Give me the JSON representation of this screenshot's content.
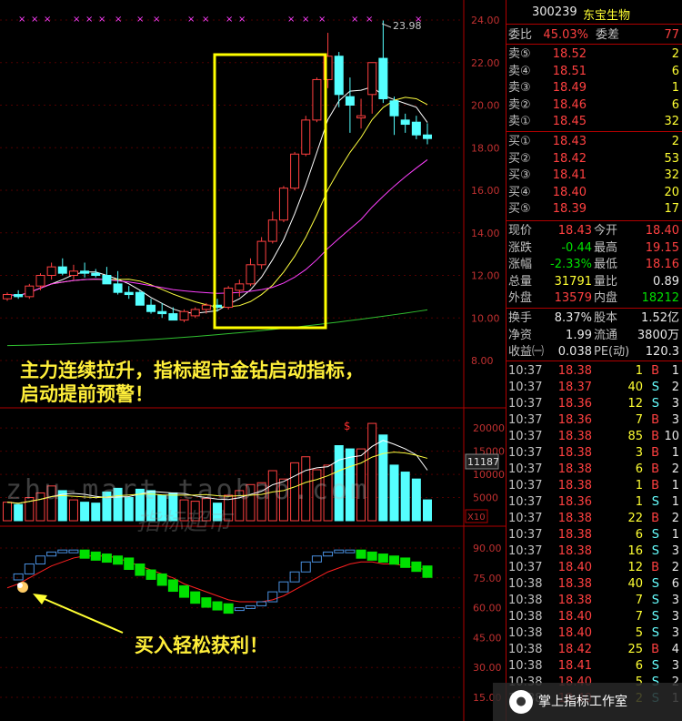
{
  "stock": {
    "code": "300239",
    "name": "东宝生物"
  },
  "order_book": {
    "weibi_label": "委比",
    "weibi": "45.03%",
    "weicha_label": "委差",
    "weicha": "77",
    "sells": [
      {
        "label": "卖⑤",
        "price": "18.52",
        "vol": "2"
      },
      {
        "label": "卖④",
        "price": "18.51",
        "vol": "6"
      },
      {
        "label": "卖③",
        "price": "18.49",
        "vol": "1"
      },
      {
        "label": "卖②",
        "price": "18.46",
        "vol": "6"
      },
      {
        "label": "卖①",
        "price": "18.45",
        "vol": "32"
      }
    ],
    "buys": [
      {
        "label": "买①",
        "price": "18.43",
        "vol": "2"
      },
      {
        "label": "买②",
        "price": "18.42",
        "vol": "53"
      },
      {
        "label": "买③",
        "price": "18.41",
        "vol": "32"
      },
      {
        "label": "买④",
        "price": "18.40",
        "vol": "20"
      },
      {
        "label": "买⑤",
        "price": "18.39",
        "vol": "17"
      }
    ]
  },
  "quote": [
    {
      "l1": "现价",
      "v1": "18.43",
      "c1": "red",
      "l2": "今开",
      "v2": "18.40",
      "c2": "red"
    },
    {
      "l1": "涨跌",
      "v1": "-0.44",
      "c1": "green",
      "l2": "最高",
      "v2": "19.15",
      "c2": "red"
    },
    {
      "l1": "涨幅",
      "v1": "-2.33%",
      "c1": "green",
      "l2": "最低",
      "v2": "18.16",
      "c2": "red"
    },
    {
      "l1": "总量",
      "v1": "31791",
      "c1": "yel",
      "l2": "量比",
      "v2": "0.89",
      "c2": "wht"
    },
    {
      "l1": "外盘",
      "v1": "13579",
      "c1": "red",
      "l2": "内盘",
      "v2": "18212",
      "c2": "green"
    }
  ],
  "quote2": [
    {
      "l1": "换手",
      "v1": "8.37%",
      "l2": "股本",
      "v2": "1.52亿"
    },
    {
      "l1": "净资",
      "v1": "1.99",
      "l2": "流通",
      "v2": "3800万"
    },
    {
      "l1": "收益㈠",
      "v1": "0.038",
      "l2": "PE(动)",
      "v2": "120.3"
    }
  ],
  "ticks": [
    [
      "10:37",
      "18.38",
      "1",
      "B",
      "1"
    ],
    [
      "10:37",
      "18.37",
      "40",
      "S",
      "2"
    ],
    [
      "10:37",
      "18.36",
      "12",
      "S",
      "3"
    ],
    [
      "10:37",
      "18.36",
      "7",
      "B",
      "3"
    ],
    [
      "10:37",
      "18.38",
      "85",
      "B",
      "10"
    ],
    [
      "10:37",
      "18.38",
      "3",
      "B",
      "1"
    ],
    [
      "10:37",
      "18.38",
      "6",
      "B",
      "2"
    ],
    [
      "10:37",
      "18.38",
      "1",
      "B",
      "1"
    ],
    [
      "10:37",
      "18.36",
      "1",
      "S",
      "1"
    ],
    [
      "10:37",
      "18.38",
      "22",
      "B",
      "2"
    ],
    [
      "10:37",
      "18.38",
      "6",
      "S",
      "1"
    ],
    [
      "10:37",
      "18.38",
      "16",
      "S",
      "3"
    ],
    [
      "10:37",
      "18.40",
      "12",
      "B",
      "2"
    ],
    [
      "10:38",
      "18.38",
      "40",
      "S",
      "6"
    ],
    [
      "10:38",
      "18.38",
      "7",
      "S",
      "3"
    ],
    [
      "10:38",
      "18.40",
      "7",
      "S",
      "3"
    ],
    [
      "10:38",
      "18.40",
      "5",
      "S",
      "3"
    ],
    [
      "10:38",
      "18.42",
      "25",
      "B",
      "4"
    ],
    [
      "10:38",
      "18.41",
      "6",
      "S",
      "3"
    ],
    [
      "10:38",
      "18.40",
      "5",
      "S",
      "2"
    ],
    [
      "10:38",
      "18.40",
      "2",
      "S",
      "1"
    ]
  ],
  "price_axis": [
    "24.00",
    "22.00",
    "20.00",
    "18.00",
    "16.00",
    "14.00",
    "12.00",
    "10.00",
    "8.00"
  ],
  "high_label": "23.98",
  "vol_axis": [
    "20000",
    "15000",
    "10000",
    "5000"
  ],
  "vol_current": "11187",
  "vol_unit": "X10",
  "osc_axis": [
    "90.00",
    "75.00",
    "60.00",
    "45.00",
    "30.00",
    "15.00"
  ],
  "annotations": {
    "main_line1": "主力连续拉升，指标超市金钻启动指标，",
    "main_line2": "启动提前预警！",
    "buy": "买入轻松获利！",
    "watermark_text": "zhu-mart.taobao.com",
    "signature": "指标超市",
    "footer": "掌上指标工作室"
  },
  "colors": {
    "up": "#ff4040",
    "down": "#5ff",
    "ma5": "#ffffff",
    "ma10": "#ffff40",
    "ma20": "#ff40ff",
    "ma60": "#30c030",
    "box": "#ffff00"
  },
  "chart_data": {
    "type": "candlestick",
    "candles": [
      [
        10.9,
        11.2,
        10.8,
        11.1
      ],
      [
        11.1,
        11.3,
        10.9,
        11.0
      ],
      [
        11.0,
        11.6,
        10.9,
        11.5
      ],
      [
        11.5,
        12.1,
        11.3,
        12.0
      ],
      [
        12.0,
        12.6,
        11.8,
        12.4
      ],
      [
        12.4,
        12.8,
        12.0,
        12.1
      ],
      [
        12.0,
        12.5,
        11.8,
        12.2
      ],
      [
        12.2,
        12.6,
        11.9,
        12.1
      ],
      [
        12.1,
        12.3,
        11.9,
        12.0
      ],
      [
        12.0,
        12.4,
        11.7,
        11.6
      ],
      [
        11.6,
        12.2,
        11.1,
        11.2
      ],
      [
        11.2,
        11.5,
        10.9,
        11.1
      ],
      [
        11.2,
        11.3,
        10.7,
        10.6
      ],
      [
        10.6,
        10.9,
        10.2,
        10.3
      ],
      [
        10.3,
        10.7,
        10.0,
        10.2
      ],
      [
        10.2,
        10.5,
        9.9,
        9.9
      ],
      [
        9.9,
        10.4,
        9.8,
        10.3
      ],
      [
        10.1,
        10.5,
        10.0,
        10.4
      ],
      [
        10.4,
        10.7,
        10.2,
        10.6
      ],
      [
        10.6,
        10.9,
        10.3,
        10.5
      ],
      [
        10.5,
        11.5,
        10.4,
        11.4
      ],
      [
        11.3,
        11.8,
        11.0,
        11.6
      ],
      [
        11.6,
        12.8,
        11.5,
        12.5
      ],
      [
        12.5,
        13.8,
        12.3,
        13.6
      ],
      [
        13.6,
        15.0,
        13.5,
        14.6
      ],
      [
        14.6,
        16.2,
        14.5,
        16.1
      ],
      [
        16.1,
        17.8,
        16.0,
        17.7
      ],
      [
        17.7,
        19.5,
        17.6,
        19.3
      ],
      [
        19.3,
        21.3,
        19.2,
        21.2
      ],
      [
        21.2,
        23.4,
        20.8,
        22.3
      ],
      [
        22.3,
        22.5,
        19.9,
        20.5
      ],
      [
        20.4,
        21.3,
        18.7,
        20.0
      ],
      [
        19.4,
        20.3,
        18.9,
        19.5
      ],
      [
        20.5,
        22.0,
        19.6,
        22.0
      ],
      [
        22.2,
        23.98,
        20.1,
        20.3
      ],
      [
        20.2,
        20.4,
        18.6,
        19.5
      ],
      [
        19.3,
        19.6,
        18.7,
        19.1
      ],
      [
        19.2,
        19.5,
        18.4,
        18.6
      ],
      [
        18.6,
        19.15,
        18.16,
        18.43
      ]
    ],
    "volumes": [
      4000,
      3500,
      5000,
      6000,
      7500,
      6500,
      4500,
      4000,
      3800,
      6200,
      7000,
      5000,
      6800,
      6500,
      5500,
      6000,
      4500,
      4200,
      4800,
      3800,
      5500,
      6500,
      7800,
      8200,
      10800,
      9000,
      12500,
      13800,
      11000,
      12000,
      16200,
      15500,
      15500,
      21000,
      18500,
      12000,
      10500,
      9000,
      4500
    ],
    "osc": [
      74,
      77,
      82,
      86,
      88,
      89,
      89,
      88,
      87,
      86,
      85,
      82,
      79,
      77,
      74,
      71,
      68,
      65,
      63,
      62,
      60,
      60,
      61,
      63,
      68,
      73,
      78,
      83,
      86,
      88,
      89,
      89,
      88,
      87,
      86,
      85,
      83,
      81,
      78
    ],
    "osc_signal": [
      70,
      72,
      75,
      78,
      81,
      83,
      85,
      86,
      86,
      86,
      85,
      83,
      81,
      79,
      77,
      75,
      72,
      70,
      68,
      66,
      64,
      63,
      63,
      63,
      64,
      66,
      69,
      72,
      75,
      78,
      80,
      82,
      83,
      83,
      82,
      82,
      81,
      80,
      79
    ]
  }
}
